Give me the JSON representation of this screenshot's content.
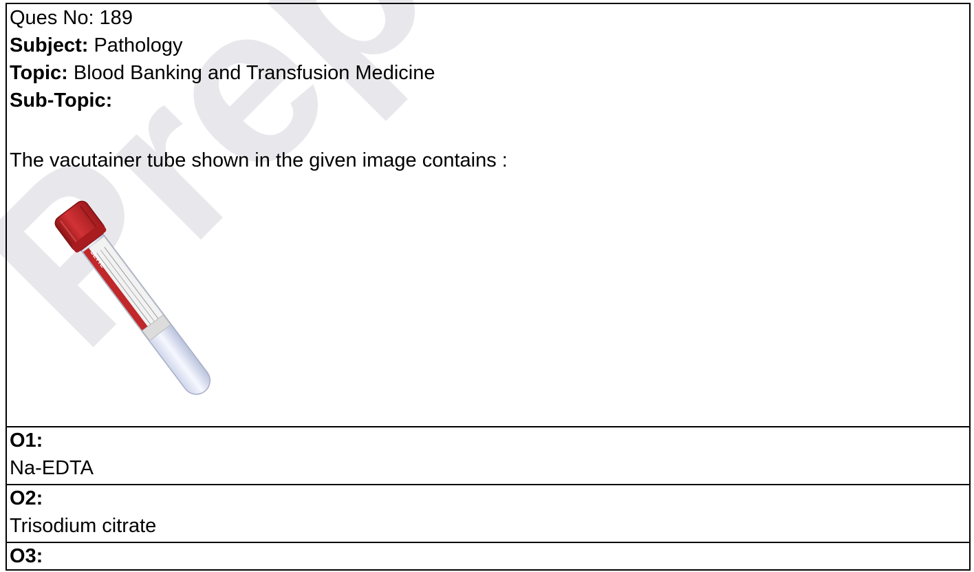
{
  "question": {
    "number_label": "Ques No: 189",
    "subject_label": "Subject:",
    "subject_value": "Pathology",
    "topic_label": "Topic:",
    "topic_value": "Blood Banking and Transfusion Medicine",
    "subtopic_label": "Sub-Topic:",
    "subtopic_value": "",
    "text": "The vacutainer tube shown in the given image contains :",
    "image": {
      "icon": "vacutainer-tube-icon",
      "cap_color": "#c0282a",
      "label_text": "UETTE"
    }
  },
  "options": [
    {
      "label": "O1:",
      "text": "Na-EDTA"
    },
    {
      "label": "O2:",
      "text": "Trisodium citrate"
    },
    {
      "label": "O3:",
      "text": ""
    }
  ],
  "watermark": {
    "text": "PrepL",
    "color": "#e9e9ee"
  }
}
